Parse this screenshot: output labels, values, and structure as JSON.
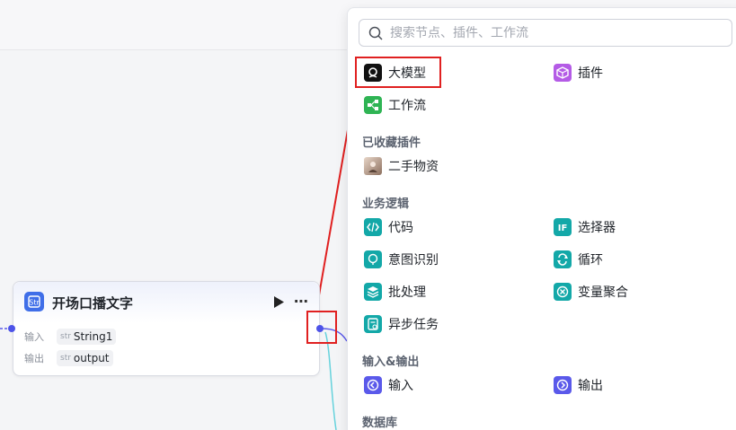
{
  "node": {
    "title": "开场口播文字",
    "input_label": "输入",
    "input_type": "str",
    "input_name": "String1",
    "output_label": "输出",
    "output_type": "str",
    "output_name": "output",
    "more_label": "⋯"
  },
  "panel": {
    "search_placeholder": "搜索节点、插件、工作流",
    "top_items": [
      {
        "label": "大模型",
        "icon": "llm-icon",
        "color": "#111111"
      },
      {
        "label": "插件",
        "icon": "plugin-cube-icon",
        "color": "#b45be6"
      },
      {
        "label": "工作流",
        "icon": "workflow-icon",
        "color": "#2fb454"
      }
    ],
    "favorites_title": "已收藏插件",
    "favorites": [
      {
        "label": "二手物资",
        "icon": "avatar-icon"
      }
    ],
    "logic_title": "业务逻辑",
    "logic_items": [
      {
        "label": "代码",
        "icon": "code-icon",
        "color": "#13a8a8"
      },
      {
        "label": "选择器",
        "icon": "if-icon",
        "color": "#13a8a8"
      },
      {
        "label": "意图识别",
        "icon": "intent-icon",
        "color": "#13a8a8"
      },
      {
        "label": "循环",
        "icon": "loop-icon",
        "color": "#13a8a8"
      },
      {
        "label": "批处理",
        "icon": "batch-icon",
        "color": "#13a8a8"
      },
      {
        "label": "变量聚合",
        "icon": "aggregate-icon",
        "color": "#13a8a8"
      },
      {
        "label": "异步任务",
        "icon": "async-task-icon",
        "color": "#13a8a8"
      }
    ],
    "io_title": "输入&输出",
    "io_items": [
      {
        "label": "输入",
        "icon": "input-icon",
        "color": "#5a59ea"
      },
      {
        "label": "输出",
        "icon": "output-icon",
        "color": "#5a59ea"
      }
    ],
    "db_title": "数据库"
  }
}
